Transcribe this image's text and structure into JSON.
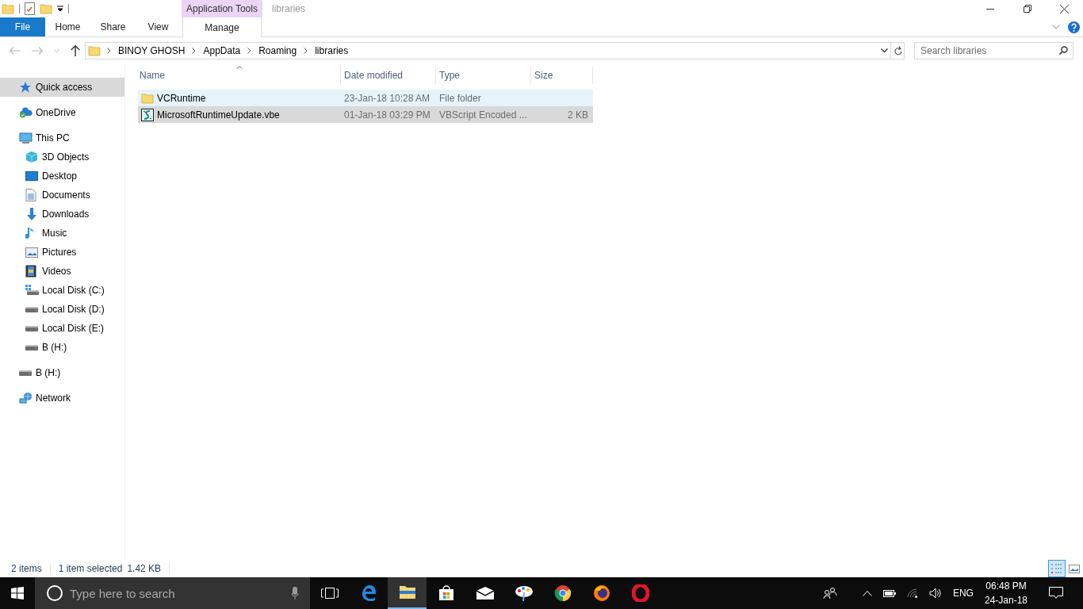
{
  "window": {
    "title": "libraries",
    "contextual_header": "Application Tools"
  },
  "ribbon": {
    "tabs": [
      {
        "label": "File",
        "kind": "file"
      },
      {
        "label": "Home",
        "kind": "tab"
      },
      {
        "label": "Share",
        "kind": "tab"
      },
      {
        "label": "View",
        "kind": "tab"
      },
      {
        "label": "Manage",
        "kind": "contextual"
      }
    ]
  },
  "address": {
    "path": [
      "BINOY GHOSH",
      "AppData",
      "Roaming",
      "libraries"
    ],
    "search_placeholder": "Search libraries"
  },
  "sidebar": {
    "items": [
      {
        "label": "Quick access",
        "kind": "star",
        "selected": true
      },
      {
        "label": "OneDrive",
        "kind": "cloud",
        "selected": false
      },
      {
        "label": "This PC",
        "kind": "pc",
        "selected": false,
        "children": [
          {
            "label": "3D Objects",
            "kind": "cube",
            "selected": false
          },
          {
            "label": "Desktop",
            "kind": "desktop",
            "selected": false
          },
          {
            "label": "Documents",
            "kind": "document",
            "selected": false
          },
          {
            "label": "Downloads",
            "kind": "download",
            "selected": false
          },
          {
            "label": "Music",
            "kind": "music",
            "selected": false
          },
          {
            "label": "Pictures",
            "kind": "pictures",
            "selected": false
          },
          {
            "label": "Videos",
            "kind": "videos",
            "selected": false
          },
          {
            "label": "Local Disk (C:)",
            "kind": "system-disk",
            "selected": false
          },
          {
            "label": "Local Disk (D:)",
            "kind": "disk",
            "selected": false
          },
          {
            "label": "Local Disk (E:)",
            "kind": "disk",
            "selected": false
          },
          {
            "label": "B (H:)",
            "kind": "disk",
            "selected": false
          }
        ]
      },
      {
        "label": "B (H:)",
        "kind": "disk",
        "selected": false
      },
      {
        "label": "Network",
        "kind": "network",
        "selected": false
      }
    ]
  },
  "table": {
    "columns": [
      {
        "label": "Name",
        "sorted": true
      },
      {
        "label": "Date modified",
        "sorted": false
      },
      {
        "label": "Type",
        "sorted": false
      },
      {
        "label": "Size",
        "sorted": false
      }
    ],
    "rows": [
      {
        "name": "VCRuntime",
        "date": "23-Jan-18 10:28 AM",
        "type": "File folder",
        "size": "",
        "kind": "folder",
        "selected": false,
        "hot": true
      },
      {
        "name": "MicrosoftRuntimeUpdate.vbe",
        "date": "01-Jan-18 03:29 PM",
        "type": "VBScript Encoded ...",
        "size": "2 KB",
        "kind": "script",
        "selected": true,
        "hot": false
      }
    ]
  },
  "status_bar": {
    "item_count": "2 items",
    "selection": "1 item selected",
    "selection_size": "1.42 KB",
    "views": [
      {
        "kind": "details",
        "selected": true
      },
      {
        "kind": "large-icons",
        "selected": false
      }
    ]
  },
  "taskbar": {
    "search_placeholder": "Type here to search",
    "apps": [
      {
        "kind": "edge",
        "active": false
      },
      {
        "kind": "explorer",
        "active": true
      },
      {
        "kind": "store",
        "active": false
      },
      {
        "kind": "mail",
        "active": false
      },
      {
        "kind": "paint",
        "active": false
      },
      {
        "kind": "chrome",
        "active": false
      },
      {
        "kind": "firefox",
        "active": false
      },
      {
        "kind": "opera",
        "active": false
      }
    ],
    "language": "ENG",
    "time": "06:48 PM",
    "date": "24-Jan-18"
  }
}
